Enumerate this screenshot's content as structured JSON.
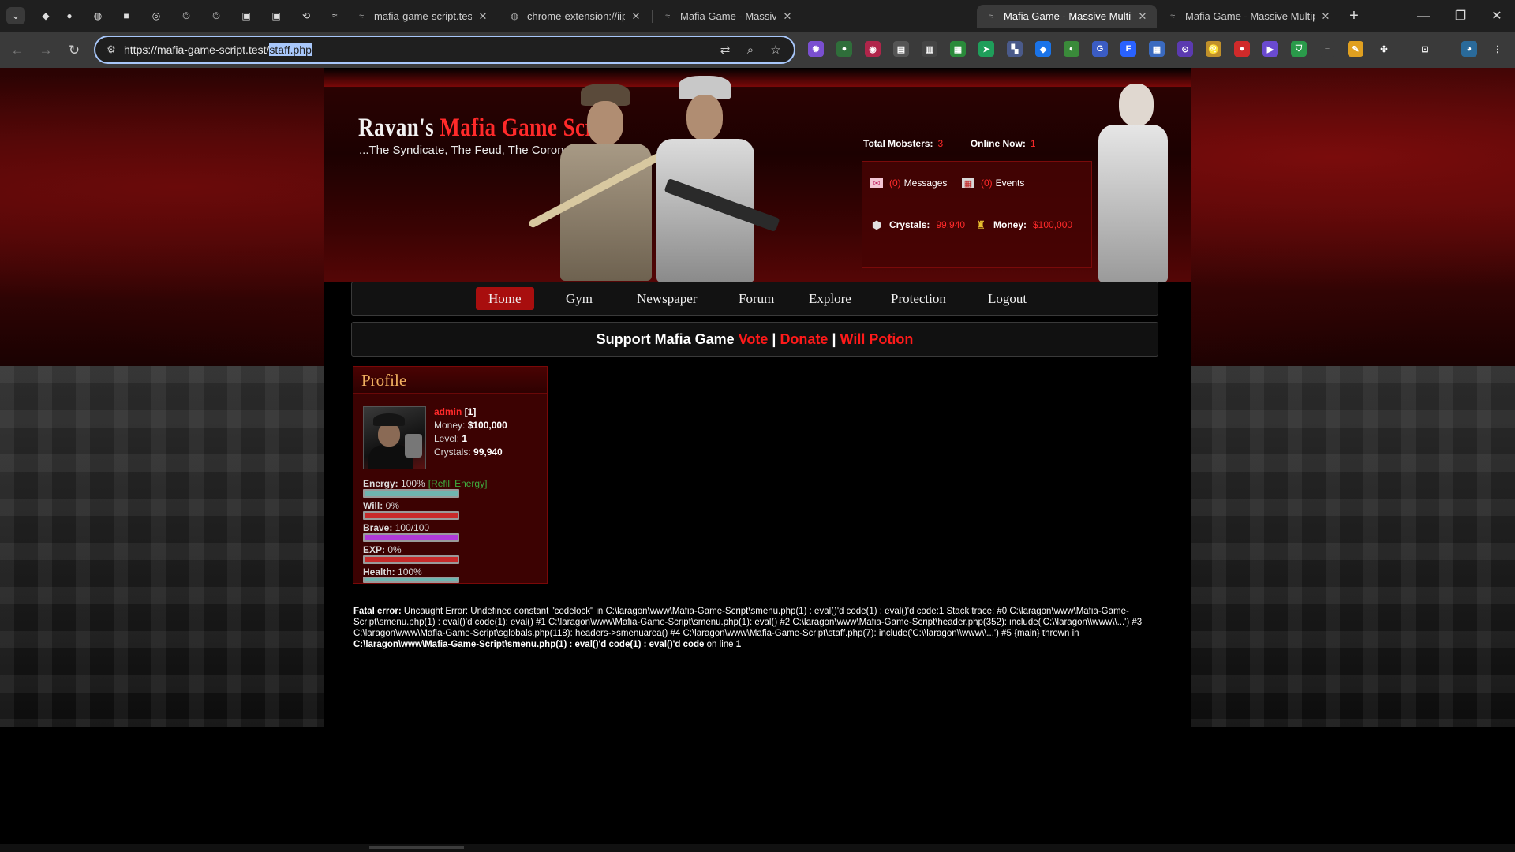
{
  "browser": {
    "tabs": [
      {
        "label": "mafia-game-script.test/test_st",
        "favicon": "code-icon"
      },
      {
        "label": "chrome-extension://iipjdmnoi",
        "favicon": "globe-icon"
      },
      {
        "label": "Mafia Game - Massive Multipl",
        "favicon": "code-icon"
      },
      {
        "label": "Mafia Game - Massive Multipl",
        "favicon": "code-icon",
        "active": true
      },
      {
        "label": "Mafia Game - Massive Multipl",
        "favicon": "code-icon"
      }
    ],
    "url_prefix": "https://mafia-game-script.test/",
    "url_selected": "staff.php"
  },
  "site": {
    "logo_white": "Ravan's",
    "logo_red": "Mafia Game Script",
    "tagline": "...The Syndicate, The Feud, The Coronation",
    "total_mobsters_label": "Total Mobsters:",
    "total_mobsters": "3",
    "online_now_label": "Online Now:",
    "online_now": "1",
    "messages_count": "(0)",
    "messages_label": "Messages",
    "events_count": "(0)",
    "events_label": "Events",
    "crystals_label": "Crystals:",
    "crystals_value": "99,940",
    "money_label": "Money:",
    "money_value": "$100,000"
  },
  "nav": [
    "Home",
    "Gym",
    "Newspaper",
    "Forum",
    "Explore",
    "Protection",
    "Logout"
  ],
  "support": {
    "text": "Support Mafia Game",
    "vote": "Vote",
    "sep": "|",
    "donate": "Donate",
    "will_potion": "Will Potion"
  },
  "profile": {
    "title": "Profile",
    "name": "admin",
    "id": "[1]",
    "money_label": "Money:",
    "money": "$100,000",
    "level_label": "Level:",
    "level": "1",
    "crystals_label": "Crystals:",
    "crystals": "99,940",
    "bars": [
      {
        "label": "Energy:",
        "value": "100%",
        "extra": "[Refill Energy]",
        "fraction": 1.0,
        "color": "#6fb5b0"
      },
      {
        "label": "Will:",
        "value": "0%",
        "extra": "",
        "fraction": 0.0,
        "color": "#c82a2a"
      },
      {
        "label": "Brave:",
        "value": "100/100",
        "extra": "",
        "fraction": 1.0,
        "color": "#b03ad8"
      },
      {
        "label": "EXP:",
        "value": "0%",
        "extra": "",
        "fraction": 0.0,
        "color": "#c82a2a"
      },
      {
        "label": "Health:",
        "value": "100%",
        "extra": "",
        "fraction": 1.0,
        "color": "#6fb5b0"
      }
    ]
  },
  "error": {
    "prefix": "Fatal error:",
    "body": " Uncaught Error: Undefined constant \"codelock\" in C:\\laragon\\www\\Mafia-Game-Script\\smenu.php(1) : eval()'d code(1) : eval()'d code:1 Stack trace: #0 C:\\laragon\\www\\Mafia-Game-Script\\smenu.php(1) : eval()'d code(1): eval() #1 C:\\laragon\\www\\Mafia-Game-Script\\smenu.php(1): eval() #2 C:\\laragon\\www\\Mafia-Game-Script\\header.php(352): include('C:\\\\laragon\\\\www\\\\...') #3 C:\\laragon\\www\\Mafia-Game-Script\\sglobals.php(118): headers->smenuarea() #4 C:\\laragon\\www\\Mafia-Game-Script\\staff.php(7): include('C:\\\\laragon\\\\www\\\\...') #5 {main} thrown in ",
    "file": "C:\\laragon\\www\\Mafia-Game-Script\\smenu.php(1) : eval()'d code(1) : eval()'d code",
    "suffix": " on line ",
    "line": "1"
  },
  "colors": {
    "accent_red": "#ff2a2a",
    "nav_active": "#a80e0e",
    "profile_bg": "#3c0202",
    "title_gold": "#f0b060"
  }
}
